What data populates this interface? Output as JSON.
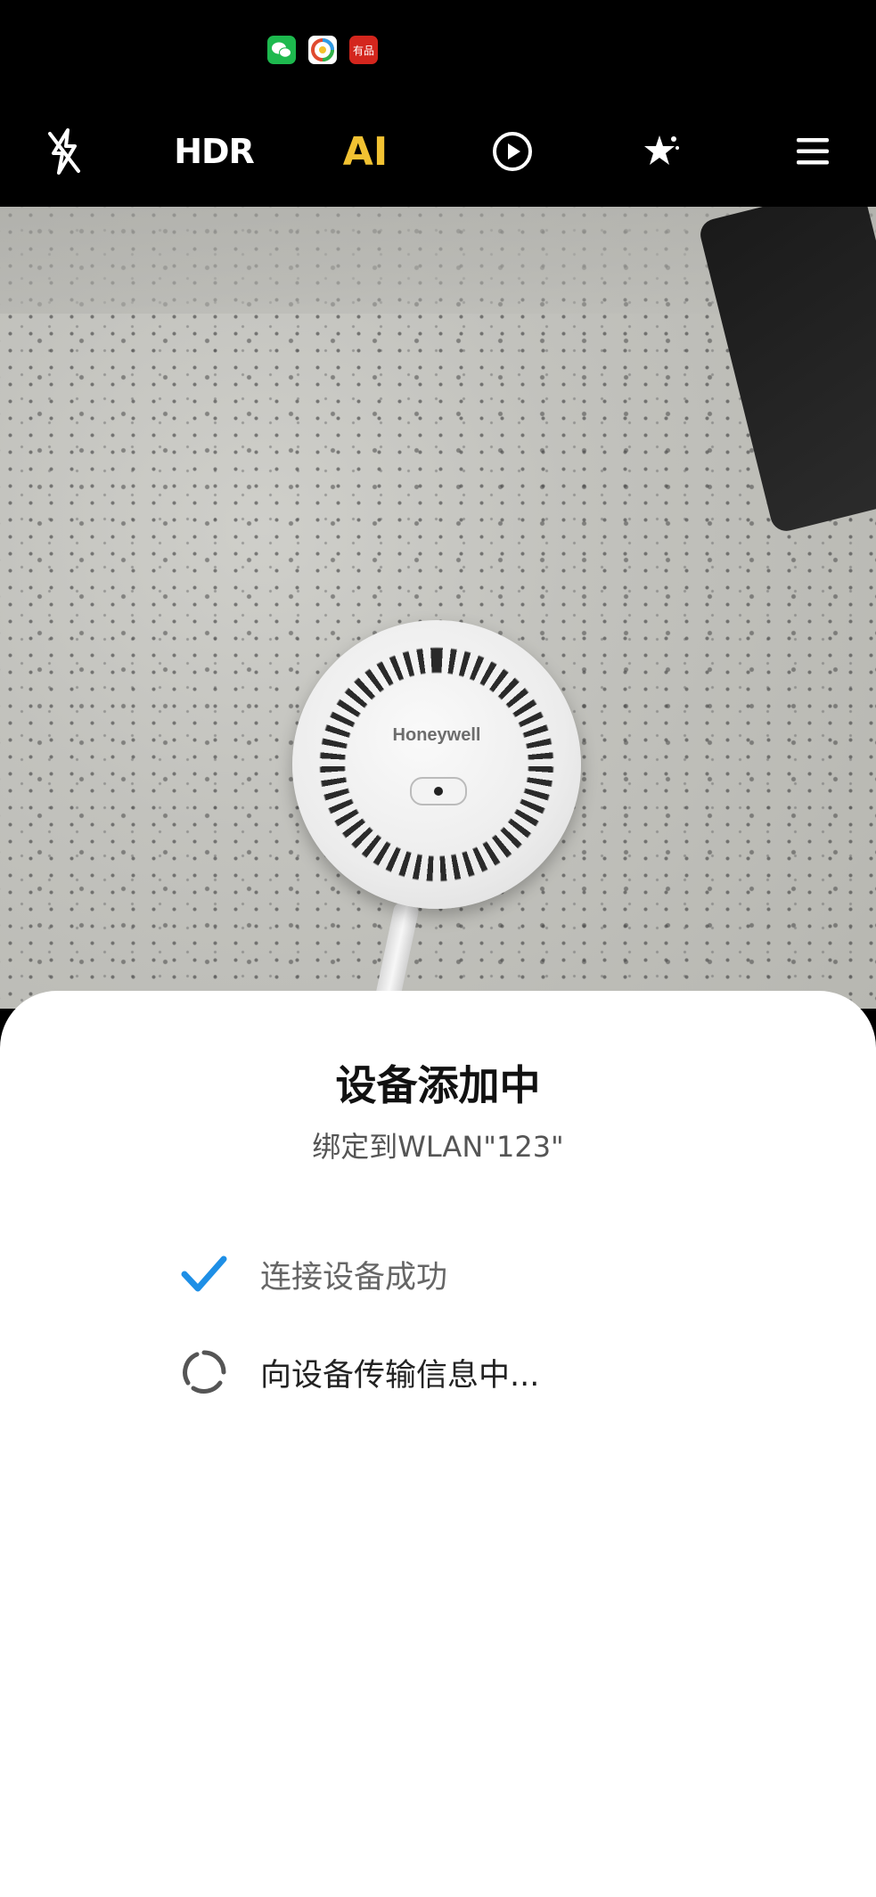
{
  "status_bar": {
    "icons": [
      "wechat-icon",
      "browser-icon",
      "store-icon"
    ],
    "store_label": "有品"
  },
  "camera_toolbar": {
    "hdr_label": "HDR",
    "ai_label": "AI",
    "ai_color": "#f2c232",
    "icons": [
      "flash-off-icon",
      "hdr-icon",
      "ai-icon",
      "live-photo-icon",
      "beauty-icon",
      "menu-icon"
    ]
  },
  "viewfinder": {
    "device_brand": "Honeywell"
  },
  "sheet": {
    "title": "设备添加中",
    "subtitle": "绑定到WLAN\"123\"",
    "steps": [
      {
        "label": "连接设备成功",
        "status": "done",
        "icon": "checkmark-icon",
        "icon_color": "#1e8fe6"
      },
      {
        "label": "向设备传输信息中...",
        "status": "in-progress",
        "icon": "spinner-icon",
        "icon_color": "#555555"
      }
    ]
  }
}
